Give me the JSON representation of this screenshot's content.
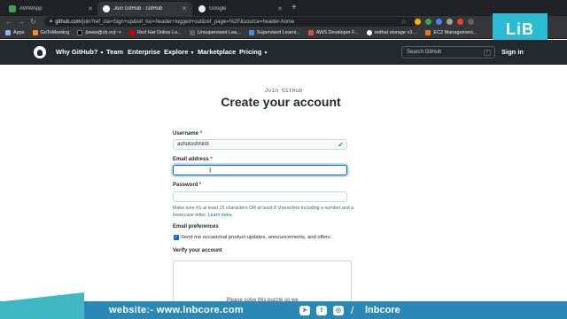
{
  "browser": {
    "tabs": [
      {
        "title": "AWWApp",
        "favicon_color": "#3fa34d"
      },
      {
        "title": "Join GitHub · GitHub",
        "favicon_color": "#ffffff"
      },
      {
        "title": "Google",
        "favicon_color": "#e8eaed"
      }
    ],
    "new_tab_label": "+",
    "url_host": "github.com",
    "url_path": "/join?ref_cta=Sign+up&ref_loc=header+logged+out&ref_page=%2F&source=header-home",
    "bookmarks": [
      {
        "label": "Apps",
        "color": "#8ab4f8"
      },
      {
        "label": "GoToMeeting",
        "color": "#f28b2d"
      },
      {
        "label": "{www@cb.vu}~>",
        "color": "#202124"
      },
      {
        "label": "Red Hat Online Le...",
        "color": "#cc0000"
      },
      {
        "label": "Unsupervised Lea...",
        "color": "#5f6368"
      },
      {
        "label": "Supervised Learni...",
        "color": "#4a90d9"
      },
      {
        "label": "AWS Developer F...",
        "color": "#e04f3b"
      },
      {
        "label": "redhat storage v3....",
        "color": "#ffffff"
      },
      {
        "label": "EC2 Management...",
        "color": "#e07b22"
      }
    ]
  },
  "overlay_logo": {
    "text": "LiB",
    "color": "#2bbcd4"
  },
  "github_nav": {
    "items": [
      "Why GitHub?",
      "Team",
      "Enterprise",
      "Explore",
      "Marketplace",
      "Pricing"
    ],
    "search_placeholder": "Search GitHub",
    "search_shortcut": "/",
    "signin_label": "Sign in"
  },
  "join": {
    "eyebrow": "Join GitHub",
    "title": "Create your account",
    "username_label": "Username",
    "username_value": "ashutoshhinb",
    "email_label": "Email address",
    "email_value": "",
    "password_label": "Password",
    "password_value": "",
    "required_mark": "*",
    "password_hint": "Make sure it's at least 15 characters OR at least 8 characters including a number and a lowercase letter.",
    "learn_more": "Learn more.",
    "email_prefs_label": "Email preferences",
    "email_prefs_checkbox": "Send me occasional product updates, announcements, and offers.",
    "verify_label": "Verify your account",
    "puzzle_text": "Please solve this puzzle so we"
  },
  "footer_banner": {
    "website": "website:-  www.lnbcore.com",
    "separator": "/",
    "handle": "lnbcore",
    "color": "#2b87b3"
  }
}
